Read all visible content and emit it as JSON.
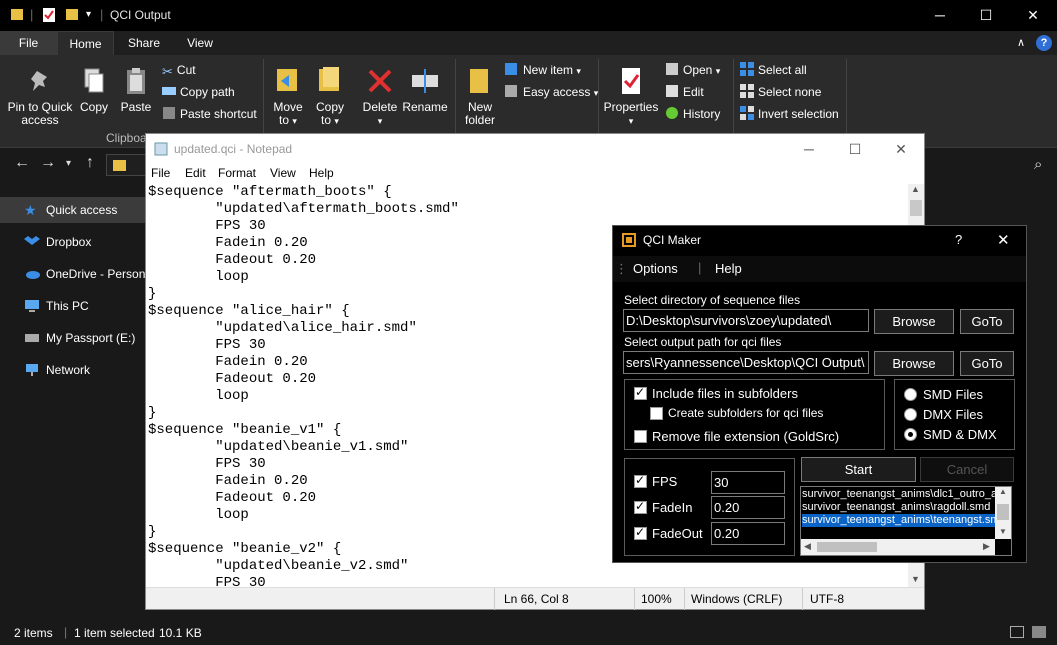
{
  "explorer": {
    "title": "QCI Output",
    "ribbon_tabs": [
      "File",
      "Home",
      "Share",
      "View"
    ],
    "clipboard": {
      "pin": "Pin to Quick access",
      "copy": "Copy",
      "paste": "Paste",
      "cut": "Cut",
      "copy_path": "Copy path",
      "paste_shortcut": "Paste shortcut",
      "group_label": "Clipboa"
    },
    "organize": {
      "move_to": "Move to",
      "copy_to": "Copy to",
      "delete": "Delete",
      "rename": "Rename"
    },
    "new": {
      "new_folder": "New folder",
      "new_item": "New item",
      "easy_access": "Easy access"
    },
    "open": {
      "properties": "Properties",
      "open": "Open",
      "edit": "Edit",
      "history": "History"
    },
    "select": {
      "select_all": "Select all",
      "select_none": "Select none",
      "invert": "Invert selection"
    },
    "nav": {
      "quick_access": "Quick access",
      "dropbox": "Dropbox",
      "onedrive": "OneDrive - Persona",
      "this_pc": "This PC",
      "passport": "My Passport (E:)",
      "network": "Network"
    },
    "status": {
      "items": "2 items",
      "selected": "1 item selected",
      "size": "10.1 KB"
    }
  },
  "notepad": {
    "title": "updated.qci - Notepad",
    "menu": [
      "File",
      "Edit",
      "Format",
      "View",
      "Help"
    ],
    "lines": [
      "$sequence \"aftermath_boots\" {",
      "        \"updated\\aftermath_boots.smd\"",
      "        FPS 30",
      "        Fadein 0.20",
      "        Fadeout 0.20",
      "        loop",
      "}",
      "$sequence \"alice_hair\" {",
      "        \"updated\\alice_hair.smd\"",
      "        FPS 30",
      "        Fadein 0.20",
      "        Fadeout 0.20",
      "        loop",
      "}",
      "$sequence \"beanie_v1\" {",
      "        \"updated\\beanie_v1.smd\"",
      "        FPS 30",
      "        Fadein 0.20",
      "        Fadeout 0.20",
      "        loop",
      "}",
      "$sequence \"beanie_v2\" {",
      "        \"updated\\beanie_v2.smd\"",
      "        FPS 30"
    ],
    "status": {
      "position": "Ln 66, Col 8",
      "zoom": "100%",
      "line_ending": "Windows (CRLF)",
      "encoding": "UTF-8"
    }
  },
  "qci": {
    "title": "QCI Maker",
    "help_glyph": "?",
    "menu": {
      "options": "Options",
      "help": "Help"
    },
    "seq_dir_label": "Select directory of sequence files",
    "seq_dir_value": "D:\\Desktop\\survivors\\zoey\\updated\\",
    "out_label": "Select output path for qci files",
    "out_value": "sers\\Ryannessence\\Desktop\\QCI Output\\",
    "browse": "Browse",
    "goto": "GoTo",
    "include_subfolders": "Include files in subfolders",
    "create_subfolders": "Create subfolders for qci files",
    "remove_ext": "Remove file extension (GoldSrc)",
    "smd_files": "SMD Files",
    "dmx_files": "DMX Files",
    "smd_dmx": "SMD & DMX",
    "fps_label": "FPS",
    "fps_value": "30",
    "fadein_label": "FadeIn",
    "fadein_value": "0.20",
    "fadeout_label": "FadeOut",
    "fadeout_value": "0.20",
    "start": "Start",
    "cancel": "Cancel",
    "list": [
      "survivor_teenangst_anims\\dlc1_outro_a",
      "survivor_teenangst_anims\\ragdoll.smd",
      "survivor_teenangst_anims\\teenangst.sm"
    ]
  }
}
